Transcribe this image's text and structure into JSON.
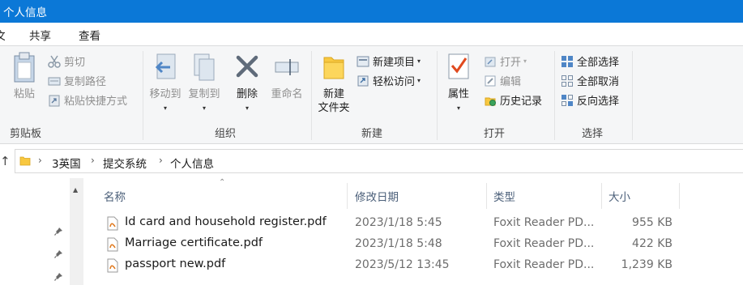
{
  "window": {
    "title": "个人信息"
  },
  "tabs": {
    "file": "文件",
    "share": "共享",
    "view": "查看"
  },
  "ribbon": {
    "clipboard": {
      "label": "剪贴板",
      "paste": "粘贴",
      "cut": "剪切",
      "copy_path": "复制路径",
      "paste_shortcut": "粘贴快捷方式"
    },
    "organize": {
      "label": "组织",
      "move_to_1": "移动到",
      "copy_to_1": "复制到",
      "delete_1": "删除",
      "rename": "重命名"
    },
    "new": {
      "label": "新建",
      "new_folder_1": "新建",
      "new_folder_2": "文件夹",
      "new_item": "新建项目",
      "easy_access": "轻松访问"
    },
    "open": {
      "label": "打开",
      "properties": "属性",
      "open": "打开",
      "edit": "编辑",
      "history": "历史记录"
    },
    "select": {
      "label": "选择",
      "select_all": "全部选择",
      "select_none": "全部取消",
      "invert": "反向选择"
    }
  },
  "nav": {
    "up": "↑"
  },
  "breadcrumb": [
    "3英国",
    "提交系统",
    "个人信息"
  ],
  "columns": {
    "name": "名称",
    "modified": "修改日期",
    "type": "类型",
    "size": "大小"
  },
  "files": [
    {
      "name": "Id card and household register.pdf",
      "modified": "2023/1/18 5:45",
      "type": "Foxit Reader PD...",
      "size": "955 KB"
    },
    {
      "name": "Marriage certificate.pdf",
      "modified": "2023/1/18 5:48",
      "type": "Foxit Reader PD...",
      "size": "422 KB"
    },
    {
      "name": "passport new.pdf",
      "modified": "2023/5/12 13:45",
      "type": "Foxit Reader PD...",
      "size": "1,239 KB"
    }
  ],
  "colors": {
    "titlebar": "#0b78d7",
    "folder": "#f8c840",
    "ribbon_bg": "#f5f6f7",
    "header_text": "#4c607a"
  }
}
